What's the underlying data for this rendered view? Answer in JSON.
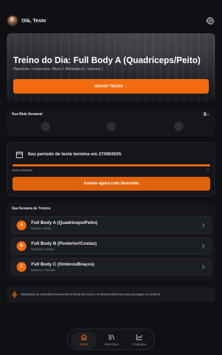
{
  "header": {
    "greeting": "Olá, Teste",
    "avatar_icon": "user-avatar",
    "settings_icon": "gear-icon"
  },
  "hero": {
    "title": "Treino do Dia: Full Body A (Quadríceps/Peito)",
    "subtitle": "Hipertrofia • 3x/semana • Bloco 1 (Metabólico) • Semana 1",
    "start_button": "INICIAR TREINO →"
  },
  "weekly_goal": {
    "label": "Sua Meta Semanal",
    "done": "0",
    "total": "/3",
    "completed_count": 0,
    "slots": 3
  },
  "trial": {
    "message": "Seu período de teste termina em 27/09/2025",
    "days_label": "Dias restantes",
    "days_value": "7",
    "progress": 1.0,
    "cta": "Assine agora com desconto"
  },
  "week": {
    "title": "Sua Semana de Treinos",
    "workouts": [
      {
        "letter": "A",
        "name": "Full Body A (Quadríceps/Peito)",
        "tags": "Pernas • Peito"
      },
      {
        "letter": "B",
        "name": "Full Body B (Posterior/Costas)",
        "tags": "Posterior • Peito"
      },
      {
        "letter": "C",
        "name": "Full Body C (Ombros/Braços)",
        "tags": "Ombros • Pernas"
      }
    ]
  },
  "tip": {
    "text": "Mantenha os cotovelos levemente à frente do tronco no desenvolvimento para proteger os ombros.",
    "icon": "lightning-icon"
  },
  "nav": {
    "items": [
      {
        "label": "Início",
        "icon": "home-icon",
        "active": true
      },
      {
        "label": "Exercícios",
        "icon": "library-icon",
        "active": false
      },
      {
        "label": "Progresso",
        "icon": "chart-icon",
        "active": false
      }
    ]
  },
  "colors": {
    "accent": "#f26b0f",
    "background": "#0e1014",
    "card": "#14161a"
  }
}
